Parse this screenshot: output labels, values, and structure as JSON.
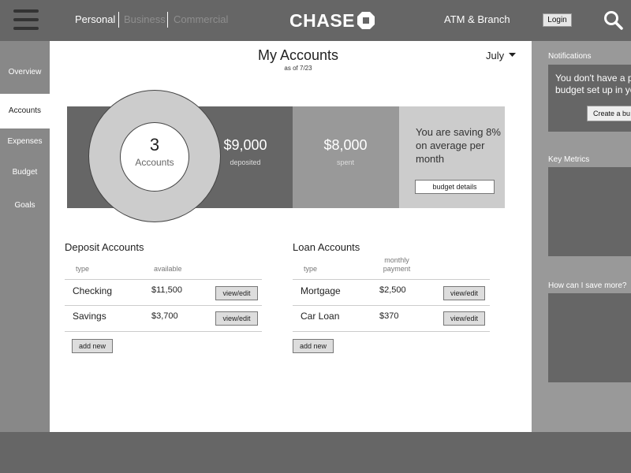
{
  "header": {
    "nav": {
      "personal": "Personal",
      "business": "Business",
      "commercial": "Commercial"
    },
    "logo": "CHASE",
    "atm": "ATM & Branch",
    "login": "Login"
  },
  "sidebar": {
    "items": [
      {
        "label": "Overview"
      },
      {
        "label": "Accounts",
        "active": true
      },
      {
        "label": "Expenses"
      },
      {
        "label": "Budget"
      },
      {
        "label": "Goals"
      }
    ]
  },
  "main": {
    "title": "My Accounts",
    "as_of": "as of 7/23",
    "month": "July",
    "summary": {
      "accounts_count": "3",
      "accounts_label": "Accounts",
      "deposited_value": "$9,000",
      "deposited_label": "deposited",
      "spent_value": "$8,000",
      "spent_label": "spent",
      "saving_text": "You are saving 8% on average per month",
      "budget_button": "budget details"
    },
    "deposit": {
      "title": "Deposit Accounts",
      "columns": {
        "type": "type",
        "available": "available"
      },
      "rows": [
        {
          "type": "Checking",
          "amount": "$11,500",
          "action": "view/edit"
        },
        {
          "type": "Savings",
          "amount": "$3,700",
          "action": "view/edit"
        }
      ],
      "add": "add new"
    },
    "loan": {
      "title": "Loan Accounts",
      "columns": {
        "type": "type",
        "monthly": "monthly",
        "payment": "payment"
      },
      "rows": [
        {
          "type": "Mortgage",
          "amount": "$2,500",
          "action": "view/edit"
        },
        {
          "type": "Car Loan",
          "amount": "$370",
          "action": "view/edit"
        }
      ],
      "add": "add new"
    }
  },
  "right": {
    "notifications_title": "Notifications",
    "notif_line1": "You don't have a p",
    "notif_line2": "budget set up in yo",
    "notif_button": "Create a bu",
    "key_metrics_title": "Key Metrics",
    "save_more_title": "How can I save more?"
  },
  "colors": {
    "header_bg": "#666666",
    "sidebar_bg": "#888888",
    "panel_bg": "#999999",
    "main_bg": "#ffffff"
  }
}
